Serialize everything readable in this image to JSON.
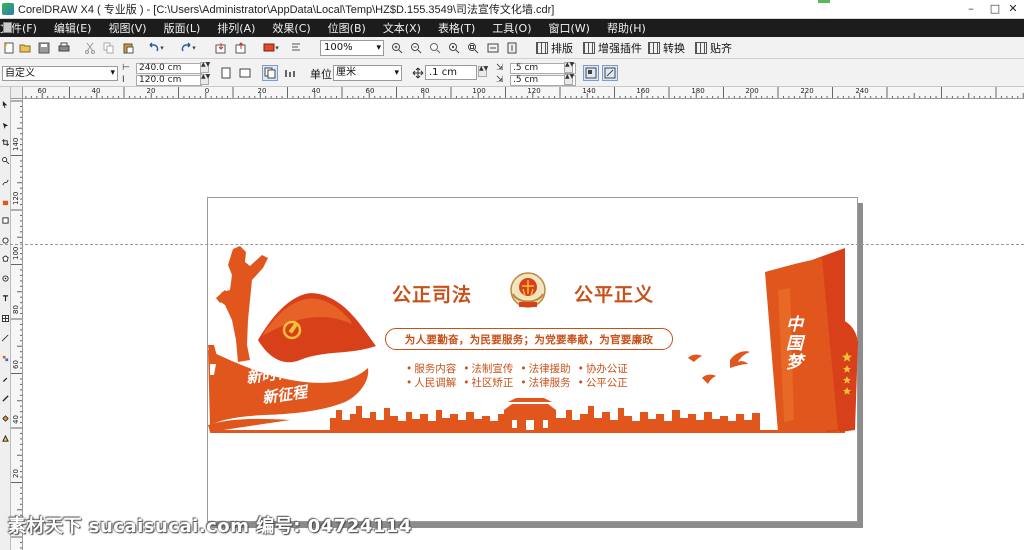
{
  "titlebar": {
    "text": "CorelDRAW X4 ( 专业版 ) - [C:\\Users\\Administrator\\AppData\\Local\\Temp\\HZ$D.155.3549\\司法宣传文化墙.cdr]",
    "minimize": "–",
    "maximize": "□",
    "close": "✕"
  },
  "menu": {
    "items": [
      "文件(F)",
      "编辑(E)",
      "视图(V)",
      "版面(L)",
      "排列(A)",
      "效果(C)",
      "位图(B)",
      "文本(X)",
      "表格(T)",
      "工具(O)",
      "窗口(W)",
      "帮助(H)"
    ]
  },
  "toolbar": {
    "zoom": "100%",
    "paiban": "排版",
    "zengqiang": "增强插件",
    "zhuanhuan": "转换",
    "tieqi": "贴齐"
  },
  "propbar": {
    "preset": "自定义",
    "width": "240.0 cm",
    "height": "120.0 cm",
    "unit_label": "单位:",
    "unit": "厘米",
    "nudge": ".1 cm",
    "dup_x": ".5 cm",
    "dup_y": ".5 cm"
  },
  "rulers": {
    "h_labels": [
      "60",
      "40",
      "20",
      "0",
      "20",
      "40",
      "60",
      "80",
      "100",
      "120",
      "140",
      "160",
      "180",
      "200",
      "220",
      "240"
    ],
    "v_labels": [
      "140",
      "120",
      "100",
      "80",
      "60",
      "40",
      "20"
    ]
  },
  "design": {
    "title_left": "公正司法",
    "title_right": "公平正义",
    "slogan": "为人要勤奋，为民要服务；为党要奉献，为官要廉政",
    "row1": [
      "服务内容",
      "法制宣传",
      "法律援助",
      "协办公证"
    ],
    "row2": [
      "人民调解",
      "社区矫正",
      "法律服务",
      "公平公正"
    ],
    "callig_1": "新时代",
    "callig_2": "新征程",
    "dream": "中国梦",
    "colors": {
      "primary": "#e0561c",
      "dark": "#c8511a",
      "flag_red": "#d8401a"
    }
  },
  "watermark": "素材天下 sucaisucai.com   编号: 04724114"
}
